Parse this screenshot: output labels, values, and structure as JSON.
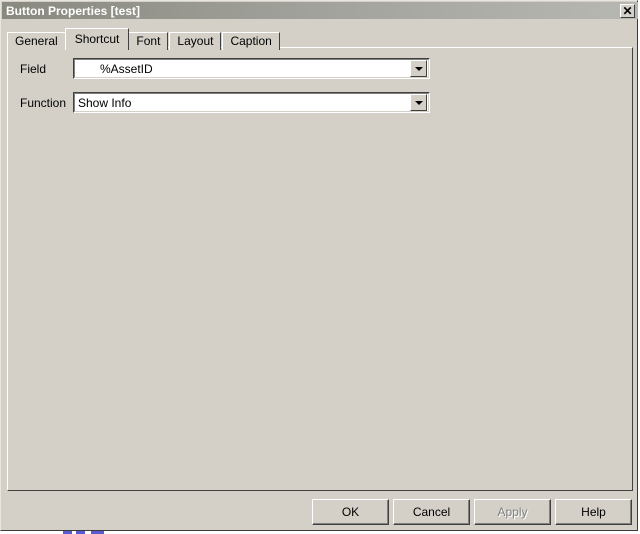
{
  "window": {
    "title": "Button Properties [test]",
    "close_icon": "close-x-icon",
    "close_label": "✕"
  },
  "tabs": [
    {
      "label": "General",
      "selected": false
    },
    {
      "label": "Shortcut",
      "selected": true
    },
    {
      "label": "Font",
      "selected": false
    },
    {
      "label": "Layout",
      "selected": false
    },
    {
      "label": "Caption",
      "selected": false
    }
  ],
  "form": {
    "field": {
      "label": "Field",
      "value": "%AssetID",
      "dropdown_icon": "chevron-down-icon"
    },
    "function": {
      "label": "Function",
      "value": "Show Info",
      "dropdown_icon": "chevron-down-icon"
    }
  },
  "buttons": {
    "ok": "OK",
    "cancel": "Cancel",
    "apply": "Apply",
    "help": "Help"
  },
  "colors": {
    "dialog_face": "#d4d0c8",
    "titlebar_inactive_left": "#898980",
    "titlebar_inactive_right": "#b8b8b2",
    "title_text": "#ffffff",
    "field_background": "#ffffff",
    "disabled_text": "#808080",
    "background_link": "#5a5ad0"
  }
}
